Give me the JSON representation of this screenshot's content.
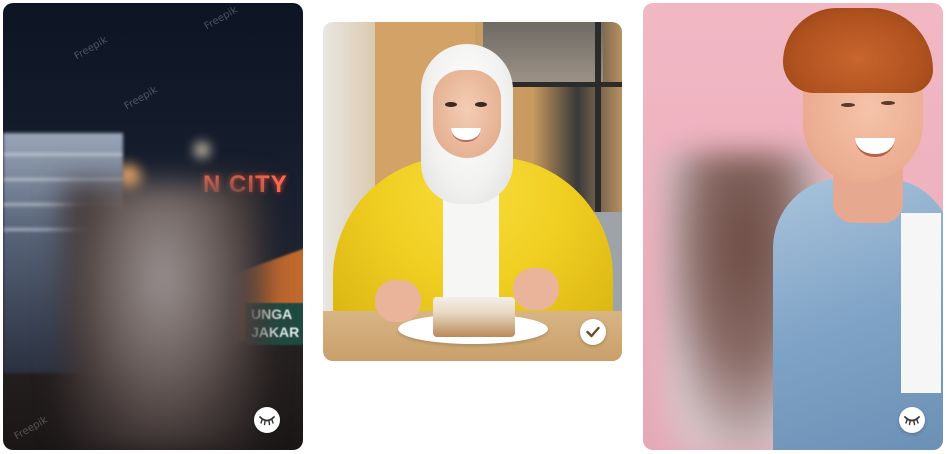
{
  "cards": [
    {
      "id": "night-city",
      "status": "hidden",
      "badge_icon": "eye-closed-icon",
      "sign_text": "N CITY",
      "signbox_lines": [
        "UNGA",
        "JAKAR"
      ],
      "watermark": "Freepik"
    },
    {
      "id": "cafe-woman",
      "status": "selected",
      "badge_icon": "checkmark-icon"
    },
    {
      "id": "pink-man",
      "status": "hidden",
      "badge_icon": "eye-closed-icon"
    }
  ],
  "colors": {
    "badge_bg": "#ffffff",
    "badge_icon": "#333333",
    "check_icon": "#6b4a2a"
  }
}
